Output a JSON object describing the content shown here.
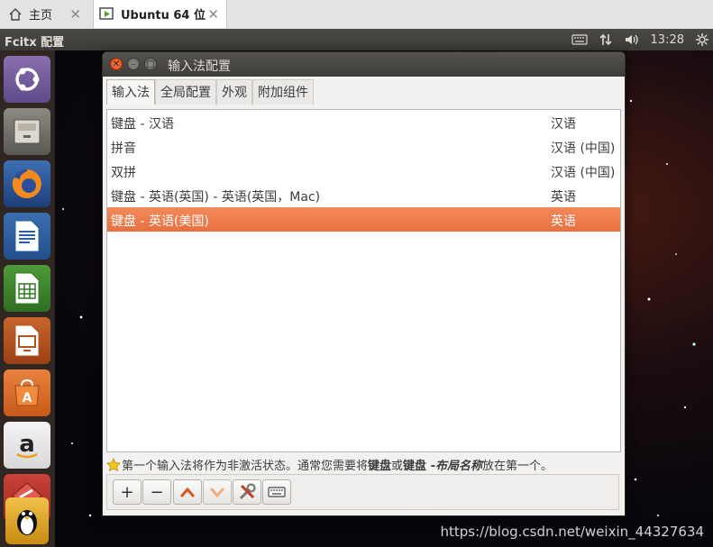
{
  "host_tabs": [
    {
      "label": "主页",
      "icon": "home-icon"
    },
    {
      "label": "Ubuntu 64 位",
      "icon": "vm-play-icon"
    }
  ],
  "topbar": {
    "app_title": "Fcitx 配置",
    "time": "13:28"
  },
  "launcher": [
    "ubuntu-dash-icon",
    "files-icon",
    "firefox-icon",
    "writer-icon",
    "calc-icon",
    "impress-icon",
    "software-center-icon",
    "amazon-icon",
    "fcitx-config-icon"
  ],
  "window": {
    "title": "输入法配置",
    "tabs": [
      {
        "label": "输入法",
        "active": true
      },
      {
        "label": "全局配置",
        "active": false
      },
      {
        "label": "外观",
        "active": false
      },
      {
        "label": "附加组件",
        "active": false
      }
    ],
    "input_methods": [
      {
        "name": "键盘 - 汉语",
        "language": "汉语",
        "selected": false
      },
      {
        "name": "拼音",
        "language": "汉语 (中国)",
        "selected": false
      },
      {
        "name": "双拼",
        "language": "汉语 (中国)",
        "selected": false
      },
      {
        "name": "键盘 - 英语(英国) - 英语(英国，Mac)",
        "language": "英语",
        "selected": false
      },
      {
        "name": "键盘 - 英语(美国)",
        "language": "英语",
        "selected": true
      }
    ],
    "hint": {
      "part1": "第一个输入法将作为非激活状态。通常您需要将",
      "bold1": "键盘",
      "part2": "或",
      "bold2": "键盘 - ",
      "italic": "布局名称",
      "part3": "放在第一个。"
    },
    "toolbar": [
      {
        "name": "add-button",
        "glyph": "+"
      },
      {
        "name": "remove-button",
        "glyph": "−"
      },
      {
        "name": "move-up-button",
        "glyph": ""
      },
      {
        "name": "move-down-button",
        "glyph": ""
      },
      {
        "name": "configure-button",
        "glyph": ""
      },
      {
        "name": "keyboard-layout-button",
        "glyph": ""
      }
    ]
  },
  "watermark": "https://blog.csdn.net/weixin_44327634",
  "colors": {
    "selection": "#e8703f",
    "accent_up": "#e0521c",
    "accent_down": "#f0a070"
  }
}
